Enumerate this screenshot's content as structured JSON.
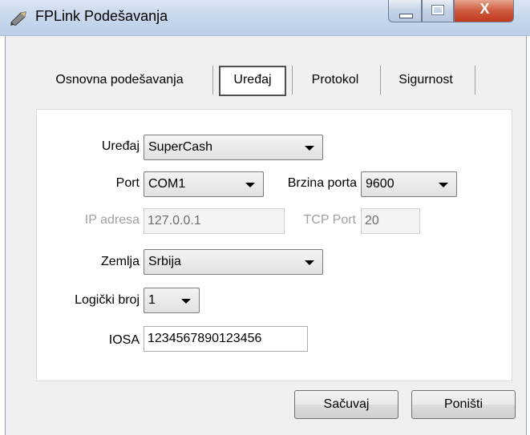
{
  "window": {
    "title": "FPLink Podešavanja",
    "close_glyph": "X"
  },
  "tabs": [
    {
      "label": "Osnovna podešavanja",
      "active": false
    },
    {
      "label": "Uređaj",
      "active": true
    },
    {
      "label": "Protokol",
      "active": false
    },
    {
      "label": "Sigurnost",
      "active": false
    }
  ],
  "form": {
    "device": {
      "label": "Uređaj",
      "value": "SuperCash"
    },
    "port": {
      "label": "Port",
      "value": "COM1"
    },
    "baud": {
      "label": "Brzina porta",
      "value": "9600"
    },
    "ip": {
      "label": "IP adresa",
      "value": "127.0.0.1"
    },
    "tcp_port": {
      "label": "TCP Port",
      "value": "20"
    },
    "country": {
      "label": "Zemlja",
      "value": "Srbija"
    },
    "logical_number": {
      "label": "Logički broj",
      "value": "1"
    },
    "iosa": {
      "label": "IOSA",
      "value": "1234567890123456"
    }
  },
  "buttons": {
    "save": "Sačuvaj",
    "cancel": "Poništi"
  },
  "colors": {
    "titlebar": "#c9d8ec",
    "close": "#c23a1f",
    "disabled_text": "#a0a0a0"
  },
  "icons": {
    "app": "pen-icon"
  }
}
